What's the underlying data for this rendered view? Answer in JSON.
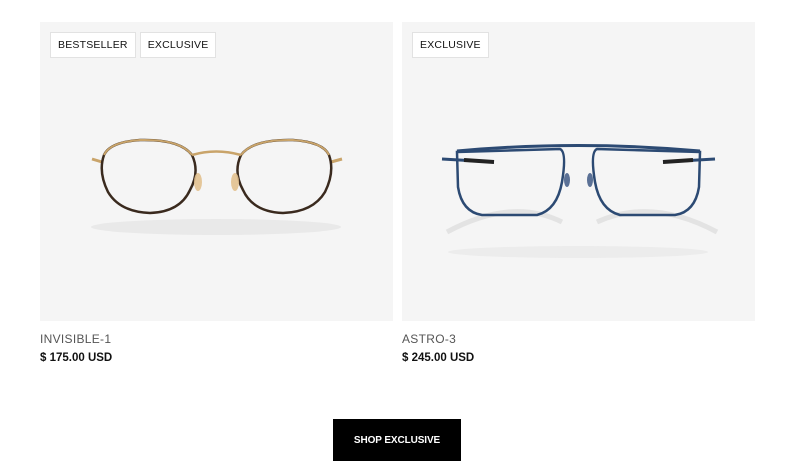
{
  "products": [
    {
      "badges": [
        "BESTSELLER",
        "EXCLUSIVE"
      ],
      "name": "INVISIBLE-1",
      "price": "$ 175.00 USD",
      "image": "round-gold-tortoise-eyeglasses"
    },
    {
      "badges": [
        "EXCLUSIVE"
      ],
      "name": "ASTRO-3",
      "price": "$ 245.00 USD",
      "image": "navy-blue-rectangular-eyeglasses"
    }
  ],
  "cta": {
    "label": "SHOP EXCLUSIVE"
  },
  "colors": {
    "image_bg": "#f5f5f5",
    "button_bg": "#000000",
    "gold_frame": "#c9a46a",
    "tortoise_frame": "#3a2a1e",
    "blue_frame": "#2c4a73"
  }
}
